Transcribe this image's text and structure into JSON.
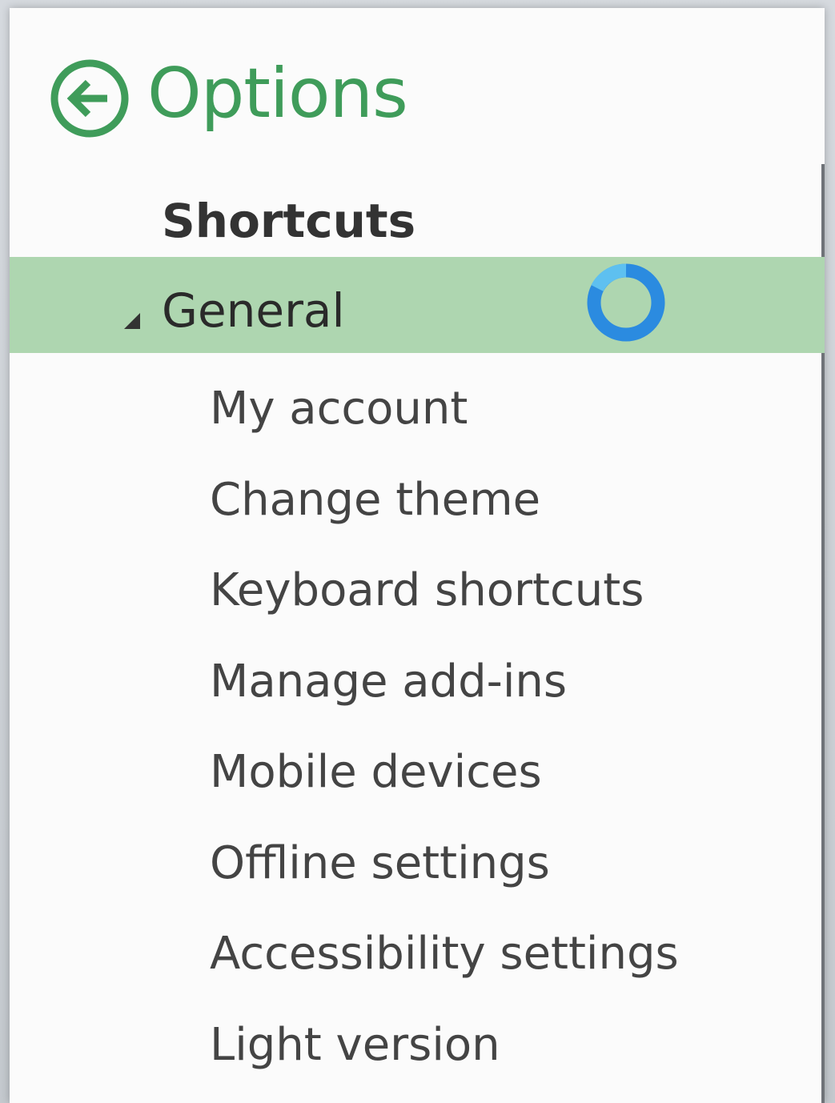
{
  "header": {
    "title": "Options",
    "back_icon": "back-arrow-circle-icon"
  },
  "section": {
    "heading": "Shortcuts"
  },
  "group": {
    "label": "General",
    "expanded": true,
    "loading": true
  },
  "items": [
    {
      "label": "My account"
    },
    {
      "label": "Change theme"
    },
    {
      "label": "Keyboard shortcuts"
    },
    {
      "label": "Manage add-ins"
    },
    {
      "label": "Mobile devices"
    },
    {
      "label": "Offline settings"
    },
    {
      "label": "Accessibility settings"
    },
    {
      "label": "Light version"
    }
  ],
  "colors": {
    "accent": "#3f9c5a",
    "selected_row": "#aed6b0",
    "spinner": "#2b8be0"
  }
}
